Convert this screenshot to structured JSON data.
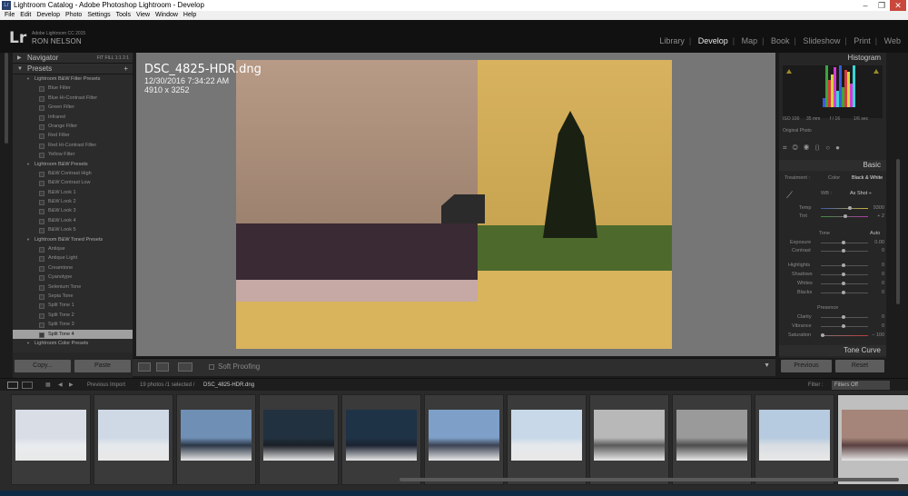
{
  "window": {
    "title": "Lightroom Catalog - Adobe Photoshop Lightroom - Develop",
    "icon": "Lr",
    "controls": [
      "–",
      "❐",
      "✕"
    ]
  },
  "menu": [
    "File",
    "Edit",
    "Develop",
    "Photo",
    "Settings",
    "Tools",
    "View",
    "Window",
    "Help"
  ],
  "identity": {
    "logo": "Lr",
    "version": "Adobe Lightroom CC 2015",
    "user": "RON NELSON"
  },
  "modules": [
    {
      "label": "Library",
      "active": false
    },
    {
      "label": "Develop",
      "active": true
    },
    {
      "label": "Map",
      "active": false
    },
    {
      "label": "Book",
      "active": false
    },
    {
      "label": "Slideshow",
      "active": false
    },
    {
      "label": "Print",
      "active": false
    },
    {
      "label": "Web",
      "active": false
    }
  ],
  "navigator": {
    "label": "Navigator",
    "zoom": "FIT  FILL  1:1  2:1"
  },
  "presets": {
    "label": "Presets",
    "add": "+",
    "rows": [
      {
        "type": "folder",
        "label": "Lightroom B&W Filter Presets"
      },
      {
        "type": "item",
        "label": "Blue Filter"
      },
      {
        "type": "item",
        "label": "Blue Hi-Contrast Filter"
      },
      {
        "type": "item",
        "label": "Green Filter"
      },
      {
        "type": "item",
        "label": "Infrared"
      },
      {
        "type": "item",
        "label": "Orange Filter"
      },
      {
        "type": "item",
        "label": "Red Filter"
      },
      {
        "type": "item",
        "label": "Red Hi-Contrast Filter"
      },
      {
        "type": "item",
        "label": "Yellow Filter"
      },
      {
        "type": "folder",
        "label": "Lightroom B&W Presets"
      },
      {
        "type": "item",
        "label": "B&W Contrast High"
      },
      {
        "type": "item",
        "label": "B&W Contrast Low"
      },
      {
        "type": "item",
        "label": "B&W Look 1"
      },
      {
        "type": "item",
        "label": "B&W Look 2"
      },
      {
        "type": "item",
        "label": "B&W Look 3"
      },
      {
        "type": "item",
        "label": "B&W Look 4"
      },
      {
        "type": "item",
        "label": "B&W Look 5"
      },
      {
        "type": "folder",
        "label": "Lightroom B&W Toned Presets"
      },
      {
        "type": "item",
        "label": "Antique"
      },
      {
        "type": "item",
        "label": "Antique Light"
      },
      {
        "type": "item",
        "label": "Creamtone"
      },
      {
        "type": "item",
        "label": "Cyanotype"
      },
      {
        "type": "item",
        "label": "Selenium Tone"
      },
      {
        "type": "item",
        "label": "Sepia Tone"
      },
      {
        "type": "item",
        "label": "Split Tone 1"
      },
      {
        "type": "item",
        "label": "Split Tone 2"
      },
      {
        "type": "item",
        "label": "Split Tone 3"
      },
      {
        "type": "item",
        "label": "Split Tone 4",
        "selected": true
      },
      {
        "type": "folder",
        "label": "Lightroom Color Presets"
      }
    ]
  },
  "leftButtons": {
    "copy": "Copy...",
    "paste": "Paste"
  },
  "photoInfo": {
    "filename": "DSC_4825-HDR.dng",
    "datetime": "12/30/2016 7:34:22 AM",
    "dimensions": "4910 x 3252"
  },
  "toolbar": {
    "softProofing": "Soft Proofing"
  },
  "histogram": {
    "label": "Histogram",
    "iso": "ISO 100",
    "focal": "35 mm",
    "aperture": "f / 16",
    "shutter": "1/6 sec",
    "original": "Original Photo"
  },
  "basic": {
    "label": "Basic",
    "treatment": "Treatment :",
    "color": "Color",
    "bw": "Black & White",
    "wb": "WB :",
    "wbValue": "As Shot ÷",
    "temp": "Temp",
    "tempVal": "9300",
    "tint": "Tint",
    "tintVal": "+ 2",
    "tone": "Tone",
    "auto": "Auto",
    "exposure": "Exposure",
    "exposureVal": "0.00",
    "contrast": "Contrast",
    "contrastVal": "0",
    "highlights": "Highlights",
    "highlightsVal": "0",
    "shadows": "Shadows",
    "shadowsVal": "0",
    "whites": "Whites",
    "whitesVal": "0",
    "blacks": "Blacks",
    "blacksVal": "0",
    "presence": "Presence",
    "clarity": "Clarity",
    "clarityVal": "0",
    "vibrance": "Vibrance",
    "vibranceVal": "0",
    "saturation": "Saturation",
    "saturationVal": "– 100"
  },
  "toneCurve": {
    "label": "Tone Curve"
  },
  "rightButtons": {
    "previous": "Previous",
    "reset": "Reset"
  },
  "filmstripBar": {
    "source": "Previous Import",
    "count": "19 photos /1 selected /",
    "file": "DSC_4825-HDR.dng",
    "filterLabel": "Filter :",
    "filter": "Filters Off"
  },
  "thumbs": [
    {
      "c1": "#d8dde6",
      "c2": "#e9ecef"
    },
    {
      "c1": "#cfd9e6",
      "c2": "#e6e9ec"
    },
    {
      "c1": "#6f8fb4",
      "c2": "#2b3646"
    },
    {
      "c1": "#223140",
      "c2": "#1a1f26"
    },
    {
      "c1": "#1f3347",
      "c2": "#1a2230"
    },
    {
      "c1": "#7ea0c8",
      "c2": "#3b4252"
    },
    {
      "c1": "#c8d8e8",
      "c2": "#e6e9ec"
    },
    {
      "c1": "#b8b8b8",
      "c2": "#5a5a5a"
    },
    {
      "c1": "#9a9a9a",
      "c2": "#4c4c4c"
    },
    {
      "c1": "#b6cbe0",
      "c2": "#d8dde2"
    },
    {
      "c1": "#a58579",
      "c2": "#5a4040",
      "selected": true
    }
  ]
}
